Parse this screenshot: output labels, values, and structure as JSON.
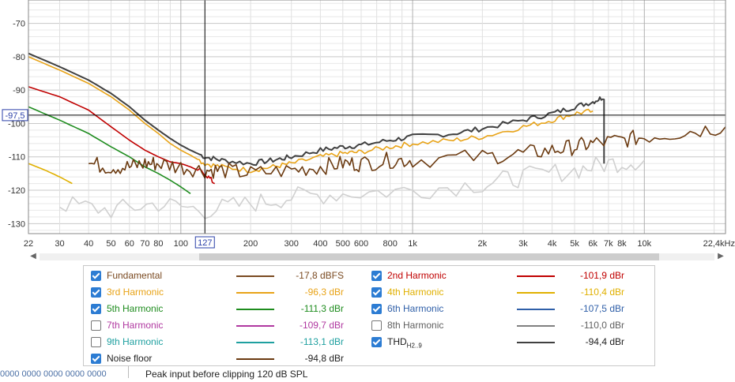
{
  "chart_data": {
    "type": "line",
    "xscale": "log",
    "xlim": [
      22,
      22400
    ],
    "ylim": [
      -133,
      -63
    ],
    "grid": true,
    "y_ticks": [
      -70,
      -80,
      -90,
      -100,
      -110,
      -120,
      -130
    ],
    "y_tick_labels": [
      "-70",
      "-80",
      "-90",
      "-100",
      "-110",
      "-120",
      "-130"
    ],
    "x_ticks": [
      22,
      30,
      40,
      50,
      60,
      70,
      80,
      100,
      200,
      300,
      400,
      500,
      600,
      800,
      1000,
      2000,
      3000,
      4000,
      5000,
      6000,
      7000,
      8000,
      10000,
      22400
    ],
    "x_tick_labels": [
      "22",
      "30",
      "40",
      "50",
      "60",
      "70",
      "80",
      "100",
      "200",
      "300",
      "400",
      "500",
      "600",
      "800",
      "1k",
      "2k",
      "3k",
      "4k",
      "5k",
      "6k",
      "7k",
      "8k",
      "10k",
      "22,4kHz"
    ],
    "cursor": {
      "x": 127,
      "y": -97.5,
      "x_label": "127",
      "y_label": "-97,5"
    },
    "series": [
      {
        "name": "THD",
        "color": "#404040",
        "width": 2,
        "x": [
          22,
          30,
          40,
          50,
          60,
          70,
          80,
          90,
          100,
          110,
          127,
          150,
          200,
          250,
          300,
          400,
          500,
          600,
          800,
          1000,
          1500,
          2000,
          3000,
          4000,
          5000,
          6000,
          6700,
          6700
        ],
        "y": [
          -79,
          -83,
          -87,
          -91,
          -95,
          -99,
          -102,
          -104.5,
          -106.5,
          -108,
          -110,
          -111,
          -112,
          -111,
          -110,
          -108,
          -107,
          -106.5,
          -105,
          -104,
          -103,
          -101.5,
          -99,
          -97,
          -95,
          -93.5,
          -92,
          -112
        ]
      },
      {
        "name": "3rd Harmonic",
        "color": "#e8a317",
        "width": 1.6,
        "x": [
          22,
          30,
          40,
          50,
          60,
          70,
          80,
          90,
          100,
          110,
          127,
          150,
          200,
          250,
          300,
          400,
          500,
          600,
          800,
          1000,
          1500,
          2000,
          3000,
          4000,
          5000,
          6000
        ],
        "y": [
          -80,
          -84,
          -88,
          -92,
          -96,
          -100,
          -103,
          -106,
          -108,
          -109.5,
          -112,
          -113,
          -114,
          -113,
          -112,
          -110,
          -109,
          -108.5,
          -107,
          -106,
          -105,
          -104,
          -101,
          -99,
          -97,
          -96.3
        ]
      },
      {
        "name": "2nd Harmonic",
        "color": "#c00000",
        "width": 1.6,
        "x": [
          22,
          30,
          40,
          50,
          60,
          70,
          80,
          90,
          100,
          110,
          127,
          140
        ],
        "y": [
          -89,
          -92,
          -96,
          -101,
          -105,
          -108,
          -110,
          -111.5,
          -112,
          -113,
          -115,
          -118
        ]
      },
      {
        "name": "5th Harmonic",
        "color": "#1e8c1e",
        "width": 1.6,
        "x": [
          22,
          30,
          40,
          50,
          60,
          70,
          80,
          90,
          100,
          110
        ],
        "y": [
          -95,
          -99,
          -103,
          -107,
          -110,
          -113,
          -115,
          -117,
          -119,
          -121
        ]
      },
      {
        "name": "4th Harmonic",
        "color": "#e0b000",
        "width": 1.6,
        "x": [
          22,
          26,
          30,
          34
        ],
        "y": [
          -112,
          -114,
          -116,
          -118
        ]
      },
      {
        "name": "8th Harmonic",
        "color": "#d0d0d0",
        "width": 1.6,
        "x": [
          30,
          50,
          80,
          127,
          200,
          300,
          500,
          1000,
          2000,
          3000,
          5000,
          7000,
          10000
        ],
        "y": [
          -124,
          -126,
          -124,
          -126,
          -124,
          -122,
          -121,
          -120,
          -118,
          -116,
          -114,
          -112,
          -111
        ]
      },
      {
        "name": "Noise floor",
        "color": "#6b3a10",
        "width": 1.6,
        "x": [
          40,
          50,
          60,
          70,
          80,
          100,
          127,
          150,
          200,
          300,
          400,
          500,
          600,
          800,
          1000,
          2000,
          3000,
          4000,
          5000,
          6000,
          8000,
          10000,
          15000,
          22400
        ],
        "y": [
          -112,
          -113,
          -113,
          -112,
          -112,
          -113,
          -114,
          -114,
          -115,
          -114,
          -113,
          -112,
          -112,
          -111,
          -111,
          -110,
          -109,
          -108,
          -107,
          -106,
          -105,
          -104,
          -102.5,
          -101
        ]
      }
    ],
    "legend": [
      {
        "name": "Fundamental",
        "value": "-17,8 dBFS",
        "checked": true,
        "color": "#7a4a21",
        "text_color": "#7a4a21"
      },
      {
        "name": "2nd Harmonic",
        "value": "-101,9 dBr",
        "checked": true,
        "color": "#c00000",
        "text_color": "#c00000"
      },
      {
        "name": "3rd Harmonic",
        "value": "-96,3 dBr",
        "checked": true,
        "color": "#e8a317",
        "text_color": "#e8a317"
      },
      {
        "name": "4th Harmonic",
        "value": "-110,4 dBr",
        "checked": true,
        "color": "#e0b000",
        "text_color": "#e0b000"
      },
      {
        "name": "5th Harmonic",
        "value": "-111,3 dBr",
        "checked": true,
        "color": "#1e8c1e",
        "text_color": "#1e8c1e"
      },
      {
        "name": "6th Harmonic",
        "value": "-107,5 dBr",
        "checked": true,
        "color": "#2f5fa8",
        "text_color": "#2f5fa8"
      },
      {
        "name": "7th Harmonic",
        "value": "-109,7 dBr",
        "checked": false,
        "color": "#b038a0",
        "text_color": "#b038a0"
      },
      {
        "name": "8th Harmonic",
        "value": "-110,0 dBr",
        "checked": false,
        "color": "#808080",
        "text_color": "#606060"
      },
      {
        "name": "9th Harmonic",
        "value": "-113,1 dBr",
        "checked": false,
        "color": "#1fa0a0",
        "text_color": "#1fa0a0"
      },
      {
        "name": "THD",
        "sub": "H2..9",
        "value": "-94,4 dBr",
        "checked": true,
        "color": "#404040",
        "text_color": "#222222"
      },
      {
        "name": "Noise floor",
        "value": "-94,8 dBr",
        "checked": true,
        "color": "#6b3a10",
        "text_color": "#222222"
      }
    ]
  },
  "status": {
    "left": "0000 0000 0000 0000 0000",
    "text": "Peak input before clipping 120 dB SPL"
  }
}
